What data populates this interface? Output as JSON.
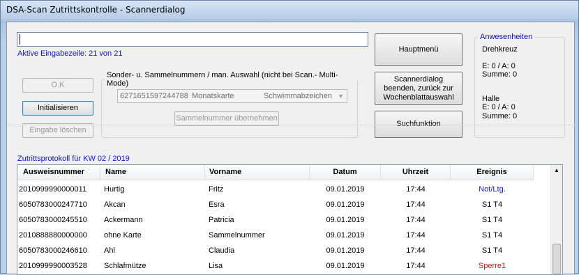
{
  "window": {
    "title": "DSA-Scan Zutrittskontrolle - Scannerdialog"
  },
  "scan": {
    "input_value": "",
    "active_line_label": "Aktive Eingabezeile: 21 von 21"
  },
  "left_buttons": {
    "ok": "O.K",
    "init": "Initialisieren",
    "clear": "Eingabe löschen"
  },
  "special": {
    "legend": "Sonder- u.  Sammelnummern / man.  Auswahl (nicht bei Scan.- Multi-Mode)",
    "selected_number": "6271651597244788",
    "selected_type": "Monatskarte",
    "selected_category": "Schwimmabzeichen",
    "take_button": "Sammelnummer übernehmen"
  },
  "right_buttons": {
    "main_menu": "Hauptmenü",
    "end_dialog": "Scannerdialog beenden, zurück zur Wochenblattauswahl",
    "search": "Suchfunktion"
  },
  "presence": {
    "legend": "Anwesenheiten",
    "locations": [
      {
        "name": "Drehkreuz",
        "counts": "E: 0 / A: 0",
        "sum": "Summe: 0"
      },
      {
        "name": "Halle",
        "counts": "E: 0 / A: 0",
        "sum": "Summe: 0"
      }
    ]
  },
  "protocol": {
    "label": "Zutrittsprotokoll für KW 02 / 2019",
    "columns": [
      "Ausweisnummer",
      "Name",
      "Vorname",
      "Datum",
      "Uhrzeit",
      "Ereignis"
    ],
    "rows": [
      {
        "id": "2010999990000011",
        "name": "Hurtig",
        "first": "Fritz",
        "date": "09.01.2019",
        "time": "17:44",
        "event": "Not/Ltg.",
        "event_color": "#1a1ad6"
      },
      {
        "id": "6050783000247710",
        "name": "Akcan",
        "first": "Esra",
        "date": "09.01.2019",
        "time": "17:44",
        "event": "S1 T4",
        "event_color": "#000000"
      },
      {
        "id": "6050783000245510",
        "name": "Ackermann",
        "first": "Patricia",
        "date": "09.01.2019",
        "time": "17:44",
        "event": "S1 T4",
        "event_color": "#000000"
      },
      {
        "id": "2010888880000000",
        "name": "ohne Karte",
        "first": "Sammelnummer",
        "date": "09.01.2019",
        "time": "17:44",
        "event": "S1 T4",
        "event_color": "#000000"
      },
      {
        "id": "6050783000246610",
        "name": "Ahl",
        "first": "Claudia",
        "date": "09.01.2019",
        "time": "17:44",
        "event": "S1 T4",
        "event_color": "#000000"
      },
      {
        "id": "2010999990003528",
        "name": "Schlafmütze",
        "first": "Lisa",
        "date": "09.01.2019",
        "time": "17:44",
        "event": "Sperre1",
        "event_color": "#e01010"
      }
    ]
  },
  "colors": {
    "link_blue": "#1010d0",
    "event_red": "#e01010"
  }
}
